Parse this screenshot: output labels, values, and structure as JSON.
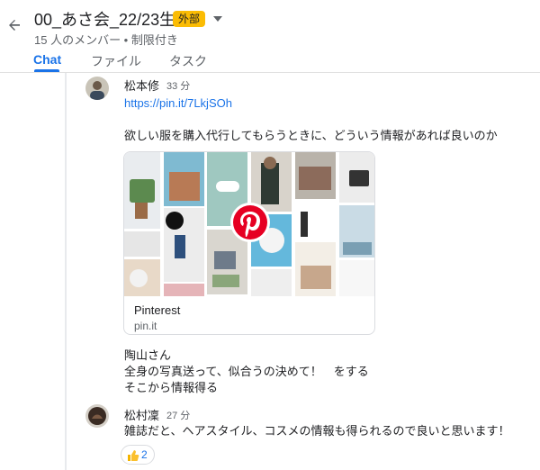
{
  "header": {
    "title": "00_あさ会_22/23生",
    "badge": "外部",
    "subtitle": "15 人のメンバー • 制限付き",
    "back_icon": "arrow-left-icon",
    "caret_icon": "caret-down-icon"
  },
  "tabs": [
    {
      "label": "Chat",
      "active": true
    },
    {
      "label": "ファイル",
      "active": false
    },
    {
      "label": "タスク",
      "active": false
    }
  ],
  "messages": {
    "first": {
      "sender": "松本修",
      "time": "33 分",
      "link": "https://pin.it/7LkjSOh",
      "text": "欲しい服を購入代行してもらうときに、どういう情報があれば良いのか",
      "preview": {
        "title": "Pinterest",
        "domain": "pin.it",
        "logo_icon": "pinterest-logo-icon"
      },
      "followup": [
        "陶山さん",
        "全身の写真送って、似合うの決めて！　をする",
        "そこから情報得る"
      ]
    },
    "second": {
      "sender": "松村凜",
      "time": "27 分",
      "text": "雑誌だと、ヘアスタイル、コスメの情報も得られるので良いと思います！",
      "reaction": {
        "emoji": "thumbs-up-icon",
        "count": "2"
      }
    }
  },
  "colors": {
    "accent": "#1a73e8",
    "badge": "#fbbc04",
    "pinterest": "#e60023"
  }
}
